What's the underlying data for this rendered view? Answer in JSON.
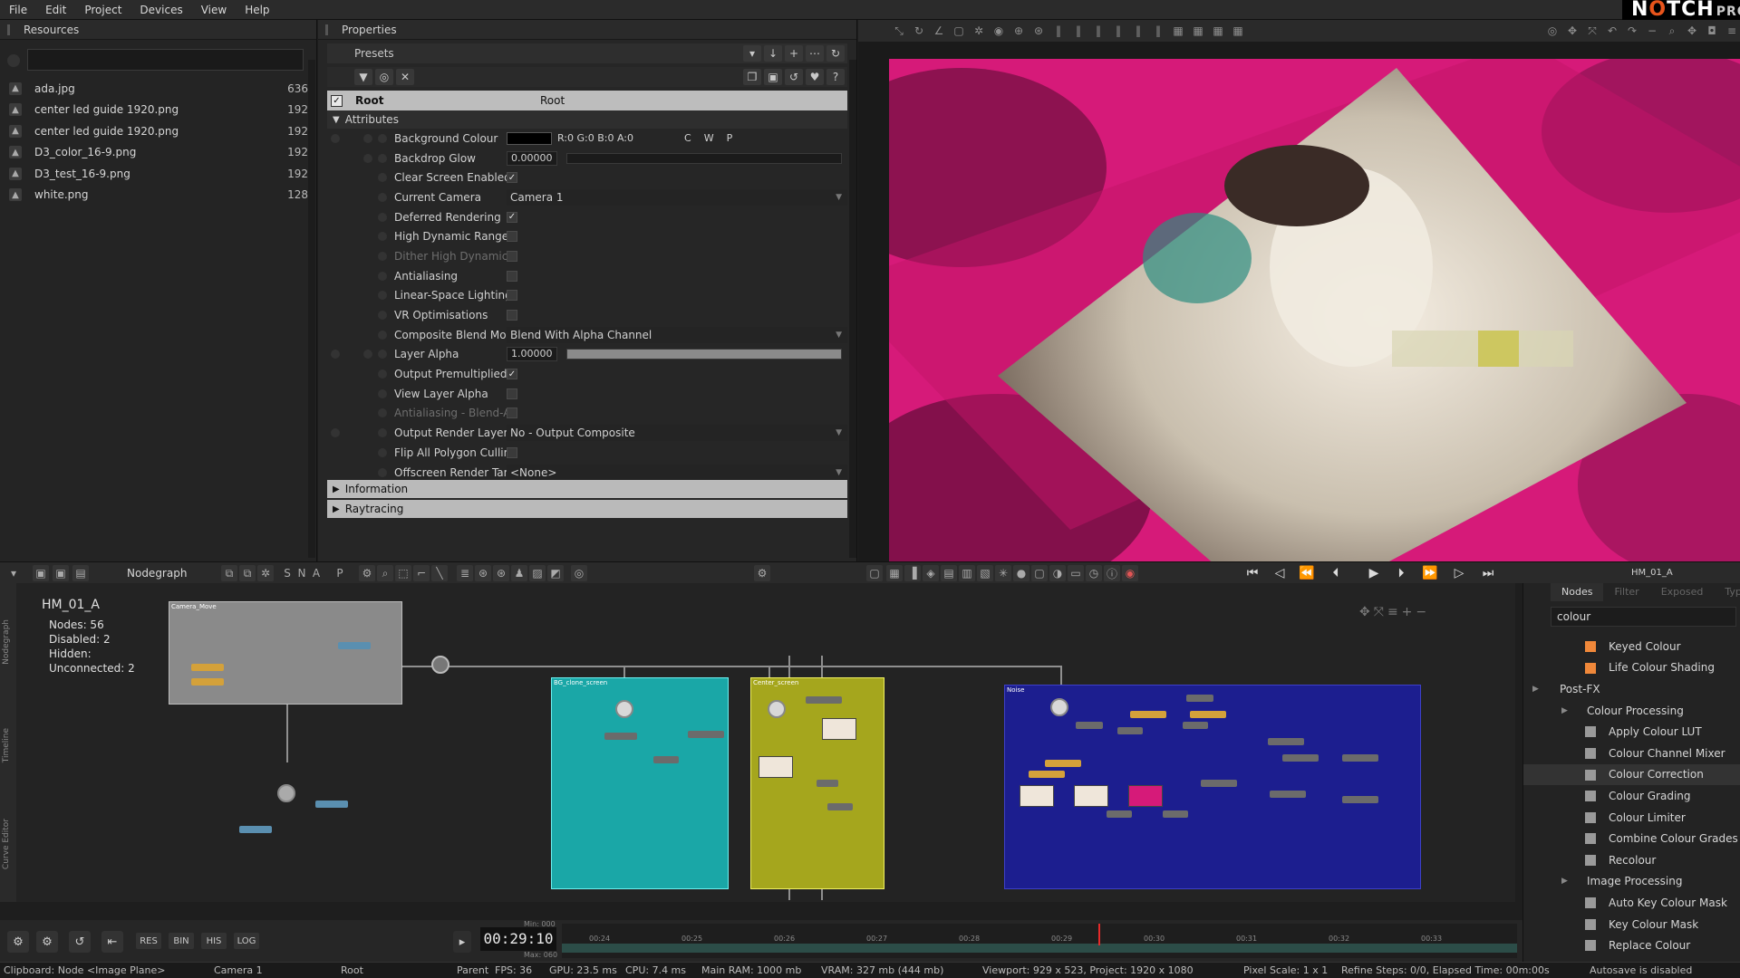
{
  "menu": [
    "File",
    "Edit",
    "Project",
    "Devices",
    "View",
    "Help"
  ],
  "brand": {
    "name_pre": "N",
    "name_o": "O",
    "name_post": "TCH",
    "suffix": "PRO"
  },
  "resources": {
    "title": "Resources",
    "search_value": "",
    "items": [
      {
        "name": "ada.jpg",
        "size": "636"
      },
      {
        "name": "center led guide 1920.png",
        "size": "192"
      },
      {
        "name": "center led guide 1920.png",
        "size": "192"
      },
      {
        "name": "D3_color_16-9.png",
        "size": "192"
      },
      {
        "name": "D3_test_16-9.png",
        "size": "192"
      },
      {
        "name": "white.png",
        "size": "128"
      }
    ]
  },
  "properties": {
    "title": "Properties",
    "presets_label": "Presets",
    "root_name": "Root",
    "root_value": "Root",
    "attributes_label": "Attributes",
    "information_label": "Information",
    "raytracing_label": "Raytracing",
    "background_colour": {
      "label": "Background Colour",
      "rgba": "R:0 G:0 B:0 A:0",
      "c": "C",
      "w": "W",
      "p": "P",
      "swatch": "#000000"
    },
    "backdrop_glow": {
      "label": "Backdrop Glow",
      "value": "0.00000",
      "level": 0
    },
    "clear_screen": {
      "label": "Clear Screen Enabled",
      "checked": true
    },
    "current_camera": {
      "label": "Current Camera",
      "value": "Camera 1"
    },
    "deferred": {
      "label": "Deferred Rendering",
      "checked": true
    },
    "hdr": {
      "label": "High Dynamic Range",
      "checked": false
    },
    "dither": {
      "label": "Dither High Dynamic",
      "checked": false
    },
    "antialiasing": {
      "label": "Antialiasing",
      "checked": false
    },
    "linear": {
      "label": "Linear-Space Lighting",
      "checked": false
    },
    "vr": {
      "label": "VR Optimisations",
      "checked": false
    },
    "blend_mode": {
      "label": "Composite Blend Moc",
      "value": "Blend With Alpha Channel"
    },
    "layer_alpha": {
      "label": "Layer Alpha",
      "value": "1.00000",
      "level": 1
    },
    "premult": {
      "label": "Output Premultiplied",
      "checked": true
    },
    "view_alpha": {
      "label": "View Layer Alpha",
      "checked": false
    },
    "aa_blend": {
      "label": "Antialiasing - Blend-A",
      "checked": false
    },
    "render_layers": {
      "label": "Output Render Layers",
      "value": "No - Output Composite"
    },
    "flip": {
      "label": "Flip All Polygon Cullir",
      "checked": false
    },
    "offscreen": {
      "label": "Offscreen Render Targ",
      "value": "<None>"
    }
  },
  "nodegraph": {
    "title": "Nodegraph",
    "layer_name": "HM_01_A",
    "toolbar_letters": [
      "S",
      "N",
      "A",
      "P"
    ],
    "stats": {
      "nodes": "Nodes:  56",
      "disabled": "Disabled:  2",
      "hidden": "Hidden:",
      "unconnected": "Unconnected:  2"
    },
    "groups": {
      "camera": "Camera_Move",
      "bg": "BG_clone_screen",
      "center": "Center_screen",
      "noise": "Noise"
    },
    "side_tabs": [
      "Nodegraph",
      "Timeline",
      "Curve Editor"
    ]
  },
  "nodes_panel": {
    "tabs": [
      "Nodes",
      "Filter",
      "Exposed",
      "Types"
    ],
    "search_value": "colour",
    "rows": [
      {
        "kind": "item",
        "label": "Keyed Colour",
        "color": "orange"
      },
      {
        "kind": "item",
        "label": "Life Colour Shading",
        "color": "orange"
      },
      {
        "kind": "cat",
        "label": "Post-FX"
      },
      {
        "kind": "sub",
        "label": "Colour Processing"
      },
      {
        "kind": "item",
        "label": "Apply Colour LUT",
        "color": "grey"
      },
      {
        "kind": "item",
        "label": "Colour Channel Mixer",
        "color": "grey"
      },
      {
        "kind": "item",
        "label": "Colour Correction",
        "color": "grey",
        "selected": true
      },
      {
        "kind": "item",
        "label": "Colour Grading",
        "color": "grey"
      },
      {
        "kind": "item",
        "label": "Colour Limiter",
        "color": "grey"
      },
      {
        "kind": "item",
        "label": "Combine Colour Grades",
        "color": "grey"
      },
      {
        "kind": "item",
        "label": "Recolour",
        "color": "grey"
      },
      {
        "kind": "sub",
        "label": "Image Processing"
      },
      {
        "kind": "item",
        "label": "Auto Key Colour Mask",
        "color": "grey"
      },
      {
        "kind": "item",
        "label": "Key Colour Mask",
        "color": "grey"
      },
      {
        "kind": "item",
        "label": "Replace Colour",
        "color": "grey"
      }
    ]
  },
  "transport": {
    "buttons": [
      "RES",
      "BIN",
      "HIS",
      "LOG"
    ],
    "timecode": "00:29:10",
    "min_label": "Min: 000",
    "max_label": "Max: 060",
    "ticks": [
      "00:24",
      "00:25",
      "00:26",
      "00:27",
      "00:28",
      "00:29",
      "00:30",
      "00:31",
      "00:32",
      "00:33"
    ]
  },
  "status": {
    "clipboard": "Clipboard: Node <Image Plane>",
    "camera": "Camera 1",
    "root": "Root",
    "parent": "Parent",
    "fps": "FPS: 36",
    "gpu": "GPU: 23.5 ms",
    "cpu": "CPU: 7.4 ms",
    "ram": "Main RAM: 1000 mb",
    "vram": "VRAM: 327 mb (444 mb)",
    "viewport": "Viewport: 929 x 523, Project: 1920 x 1080",
    "pixel_scale": "Pixel Scale: 1 x 1",
    "refine": "Refine Steps: 0/0, Elapsed Time: 00m:00s",
    "autosave": "Autosave is disabled"
  },
  "colors": {
    "accent_pink": "#d61a79",
    "group_teal": "#1aa7a7",
    "group_yellow": "#a5a61d",
    "group_blue": "#1c1e8f",
    "playhead": "#e52a2a"
  }
}
